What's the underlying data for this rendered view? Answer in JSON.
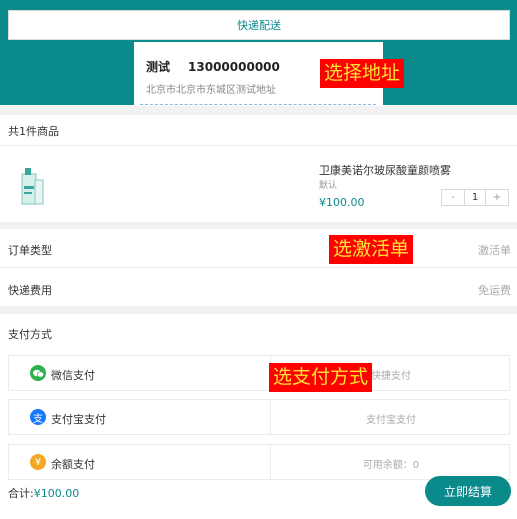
{
  "header": {
    "delivery_label": "快递配送",
    "contact_name": "测试",
    "contact_phone": "13000000000",
    "address": "北京市北京市东城区测试地址"
  },
  "annotations": {
    "select_address": "选择地址",
    "select_activation_order": "选激活单",
    "select_payment_method": "选支付方式"
  },
  "goods": {
    "count_label": "共1件商品",
    "items": [
      {
        "name": "卫康美诺尔玻尿酸童颜喷雾",
        "spec": "默认",
        "price": "¥100.00",
        "quantity": "1"
      }
    ],
    "minus": "-",
    "plus": "+"
  },
  "order_type": {
    "label": "订单类型",
    "value": "激活单"
  },
  "shipping_fee": {
    "label": "快递费用",
    "value": "免运费"
  },
  "payment": {
    "title": "支付方式",
    "methods": [
      {
        "name": "微信支付",
        "hint": "快捷支付",
        "icon": "wechat-icon",
        "color": "#2bb24c"
      },
      {
        "name": "支付宝支付",
        "hint": "支付宝支付",
        "icon": "alipay-icon",
        "color": "#1677ff"
      },
      {
        "name": "余额支付",
        "hint": "可用余额：0",
        "icon": "balance-icon",
        "color": "#f5a623"
      }
    ]
  },
  "footer": {
    "total_label": "合计:",
    "total_amount": "¥100.00",
    "checkout_label": "立即结算"
  },
  "colors": {
    "accent": "#0b8a8c",
    "annotation_bg": "#ff0000",
    "annotation_text": "#ffe033"
  }
}
